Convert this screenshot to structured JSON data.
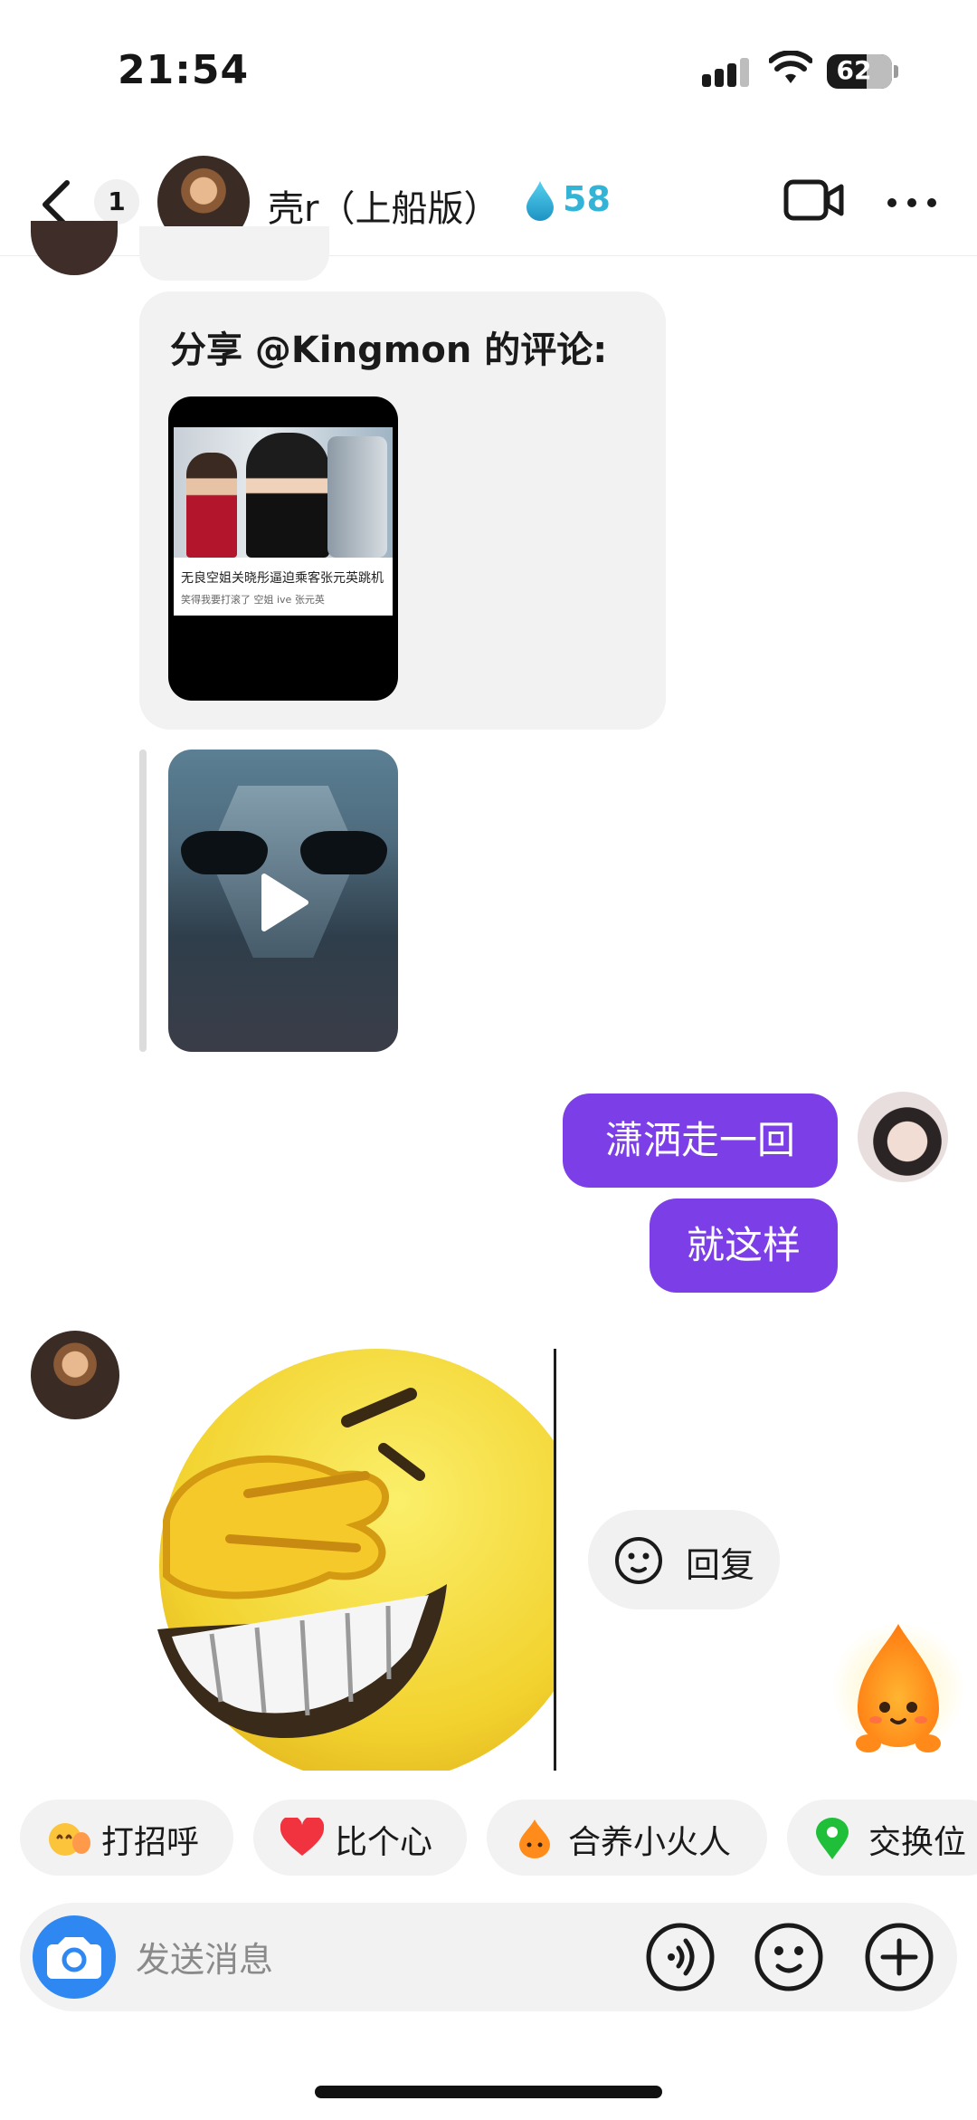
{
  "status_bar": {
    "time": "21:54",
    "battery": "62"
  },
  "header": {
    "unread_count": "1",
    "contact_name": "壳r（上船版）",
    "streak_count": "58",
    "streak_icon": "water-drop-icon",
    "colors": {
      "streak": "#33b3d6"
    }
  },
  "messages": {
    "shared_card": {
      "title": "分享 @Kingmon 的评论:",
      "thumb_caption": "无良空姐关晓彤逼迫乘客张元英跳机",
      "thumb_sub": "笑得我要打滚了 空姐 ive 张元英"
    },
    "mine": [
      {
        "text": "潇洒走一回"
      },
      {
        "text": "就这样"
      }
    ],
    "reply_chip": {
      "label": "回复"
    }
  },
  "quick_actions": [
    {
      "label": "打招呼",
      "icon": "wave-hand-emoji-icon"
    },
    {
      "label": "比个心",
      "icon": "heart-icon"
    },
    {
      "label": "合养小火人",
      "icon": "flame-sprite-icon"
    },
    {
      "label": "交换位",
      "icon": "location-pin-icon"
    }
  ],
  "input": {
    "placeholder": "发送消息"
  },
  "colors": {
    "my_bubble": "#7c3ee6",
    "camera_button": "#2f88f2",
    "chip_background": "#f2f2f2"
  }
}
